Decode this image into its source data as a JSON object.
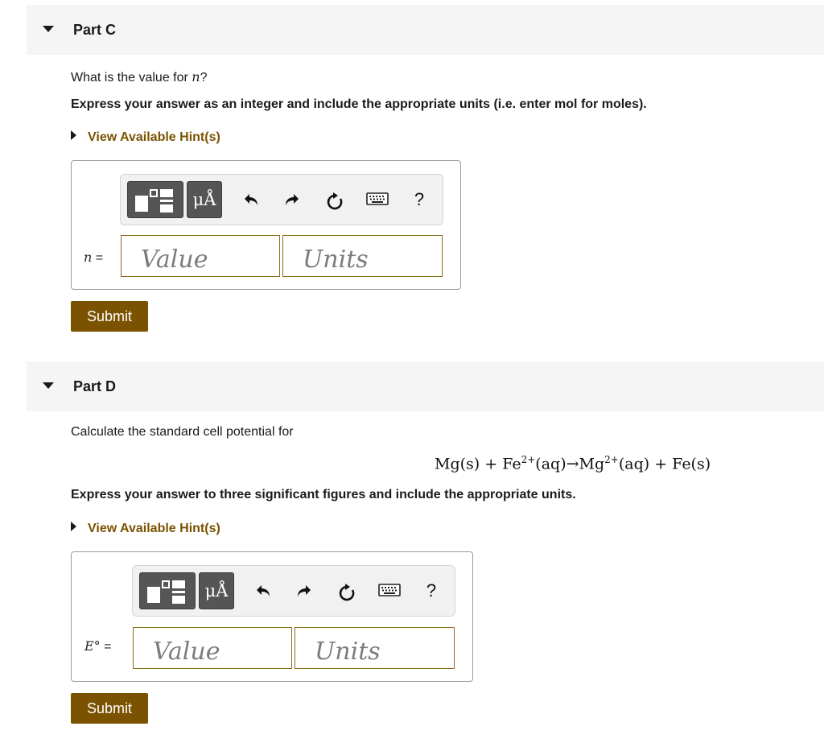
{
  "part_c": {
    "title": "Part C",
    "question_prefix": "What is the value for ",
    "question_var": "n",
    "question_suffix": "?",
    "instruction": "Express your answer as an integer and include the appropriate units (i.e. enter mol for moles).",
    "hint_label": "View Available Hint(s)",
    "variable": "n",
    "equals": "=",
    "value_placeholder": "Value",
    "units_placeholder": "Units",
    "submit_label": "Submit"
  },
  "part_d": {
    "title": "Part D",
    "question": "Calculate the standard cell potential for",
    "equation": {
      "mg_s": "Mg(s) + Fe",
      "fe_charge": "2+",
      "mid": "(aq)→Mg",
      "mg_charge": "2+",
      "end": "(aq) + Fe(s)"
    },
    "instruction": "Express your answer to three significant figures and include the appropriate units.",
    "hint_label": "View Available Hint(s)",
    "variable": "E°",
    "equals": "=",
    "value_placeholder": "Value",
    "units_placeholder": "Units",
    "submit_label": "Submit"
  },
  "toolbar": {
    "units_button": "μÅ",
    "help": "?",
    "icons": [
      "templates-icon",
      "units-icon",
      "undo-icon",
      "redo-icon",
      "reset-icon",
      "keyboard-icon",
      "help-icon"
    ]
  },
  "colors": {
    "accent": "#7a5200",
    "header_bg": "#f5f5f5",
    "toolbar_bg": "#f1f1f1",
    "toolbar_button": "#555555"
  }
}
